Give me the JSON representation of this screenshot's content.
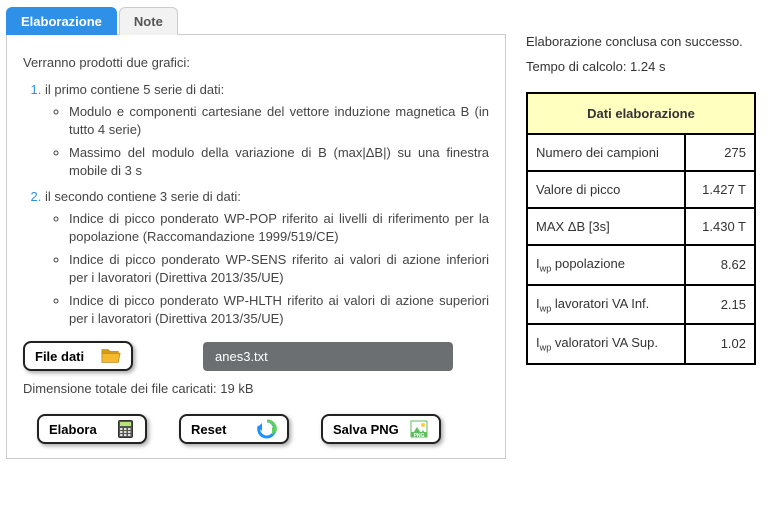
{
  "tabs": {
    "elaborazione": "Elaborazione",
    "note": "Note"
  },
  "panel": {
    "intro": "Verranno prodotti due grafici:",
    "item1": "il primo contiene 5 serie di dati:",
    "item1_sub1": "Modulo e componenti cartesiane del vettore induzione magnetica B (in tutto 4 serie)",
    "item1_sub2": "Massimo del modulo della variazione di B (max|ΔB|) su una finestra mobile di 3 s",
    "item2": "il secondo contiene 3 serie di dati:",
    "item2_sub1": "Indice di picco ponderato WP-POP riferito ai livelli di riferimento per la popolazione (Raccomandazione 1999/519/CE)",
    "item2_sub2": "Indice di picco ponderato WP-SENS riferito ai valori di azione inferiori per i lavoratori (Direttiva 2013/35/UE)",
    "item2_sub3": "Indice di picco ponderato WP-HLTH riferito ai valori di azione superiori per i lavoratori (Direttiva 2013/35/UE)"
  },
  "file": {
    "button": "File dati",
    "name": "anes3.txt",
    "size_line": "Dimensione totale dei file caricati: 19 kB"
  },
  "buttons": {
    "elabora": "Elabora",
    "reset": "Reset",
    "salva_png": "Salva PNG"
  },
  "status": {
    "line1": "Elaborazione conclusa con successo.",
    "line2": "Tempo di calcolo: 1.24 s"
  },
  "results": {
    "title": "Dati elaborazione",
    "rows": [
      {
        "label_html": "Numero dei campioni",
        "value": "275"
      },
      {
        "label_html": "Valore di picco",
        "value": "1.427 T"
      },
      {
        "label_html": "MAX ΔB [3s]",
        "value": "1.430 T"
      },
      {
        "label_html": "I<sub>wp</sub> popolazione",
        "value": "8.62"
      },
      {
        "label_html": "I<sub>wp</sub> lavoratori VA Inf.",
        "value": "2.15"
      },
      {
        "label_html": "I<sub>wp</sub> valoratori VA Sup.",
        "value": "1.02"
      }
    ]
  }
}
